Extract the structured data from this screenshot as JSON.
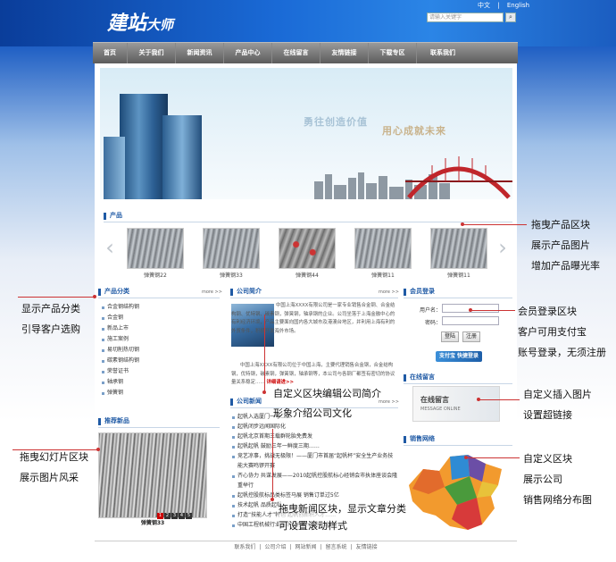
{
  "header": {
    "logo_main": "建站",
    "logo_sub": "大师",
    "lang_cn": "中文",
    "lang_sep": "|",
    "lang_en": "English",
    "search_placeholder": "请输入关键字",
    "search_icon": "search-icon"
  },
  "nav": [
    "首页",
    "关于我们",
    "新闻资讯",
    "产品中心",
    "在线留言",
    "友情链接",
    "下载专区",
    "联系我们"
  ],
  "hero": {
    "text1": "勇往创造价值",
    "text2": "用心成就未来"
  },
  "products": {
    "title": "产品",
    "items": [
      {
        "caption": "弹簧钢22"
      },
      {
        "caption": "弹簧钢33"
      },
      {
        "caption": "弹簧钢44"
      },
      {
        "caption": "弹簧钢11"
      },
      {
        "caption": "弹簧钢11"
      }
    ]
  },
  "categories": {
    "title": "产品分类",
    "more": "more >>",
    "items": [
      "合金钢结构钢",
      "合金钢",
      "新品上市",
      "施工案例",
      "易切削热切钢",
      "碳素钢结构钢",
      "荣誉证书",
      "轴承钢",
      "弹簧钢"
    ]
  },
  "intro": {
    "title": "公司简介",
    "more": "more >>",
    "para1": "中国上海XXXX有限公司是一家专业销售合金钢、合金结构钢、优特钢、碳素钢，弹簧钢，轴承钢的企业。公司坐落于上海金融中心的有利经济环境，产品主要面向国内各大城市及港澳台地区，并利用上海有利的外贸条件，积极开发海外市场。",
    "para2": "中国上海XXXX有限公司位于中国上海，主要代理销售合金钢，合金结构钢，优特钢，碳素钢，弹簧钢，轴承钢等，本公司与各钢厂都签有密切的协议量关系稳定……",
    "detail": "详细请进>>"
  },
  "news": {
    "title": "公司新闻",
    "more": "more >>",
    "items": [
      "起帆入选厦门一号……",
      "起帆闭步远闻国际化",
      "起帆北京首期三载群轮胎免费发",
      "起帆起帆 鼓励三年一鲜度三期……",
      "竞艺凉事，挑战无极限！——厦门市首届“起帆杯”安全生产业务技能大赛鸣锣开赛",
      "齐心协力 共谋发展——2010起帆控股航标心经销会市执体座谈会隆重举行",
      "起帆控股航标品类标签马展 销售订单过5亿",
      "技术起帆 品质起帆",
      "打造“技能人才”特色 起帆创新积人才……",
      "中国工程机械行业重点推荐工业起帆城市"
    ]
  },
  "member": {
    "title": "会员登录",
    "user_label": "用户名：",
    "pwd_label": "密码：",
    "login": "登陆",
    "register": "注册",
    "alipay": "支付宝 快捷登录"
  },
  "message": {
    "title": "在线留言",
    "card_title": "在线留言",
    "card_sub": "MESSAGE ONLINE"
  },
  "sales": {
    "title": "销售网络"
  },
  "recommend": {
    "title": "推荐新品",
    "caption": "弹簧钢33",
    "dots": [
      "1",
      "2",
      "3",
      "4",
      "5"
    ]
  },
  "annotations": {
    "products": [
      "拖曳产品区块",
      "展示产品图片",
      "增加产品曝光率"
    ],
    "categories": [
      "显示产品分类",
      "引导客户选购"
    ],
    "member": [
      "会员登录区块",
      "客户可用支付宝",
      "账号登录，无须注册"
    ],
    "intro": [
      "自定义区块编辑公司简介",
      "形象介绍公司文化"
    ],
    "message": [
      "自定义插入图片",
      "设置超链接"
    ],
    "slide": [
      "拖曳幻灯片区块",
      "展示图片风采"
    ],
    "sales": [
      "自定义区块",
      "展示公司",
      "销售网络分布图"
    ],
    "news": [
      "拖曳新闻区块，显示文章分类",
      "可设置滚动样式"
    ]
  },
  "footer": [
    "联系我们",
    "|",
    "公司介绍",
    "|",
    "网站新闻",
    "|",
    "留言系统",
    "|",
    "友情链接"
  ]
}
